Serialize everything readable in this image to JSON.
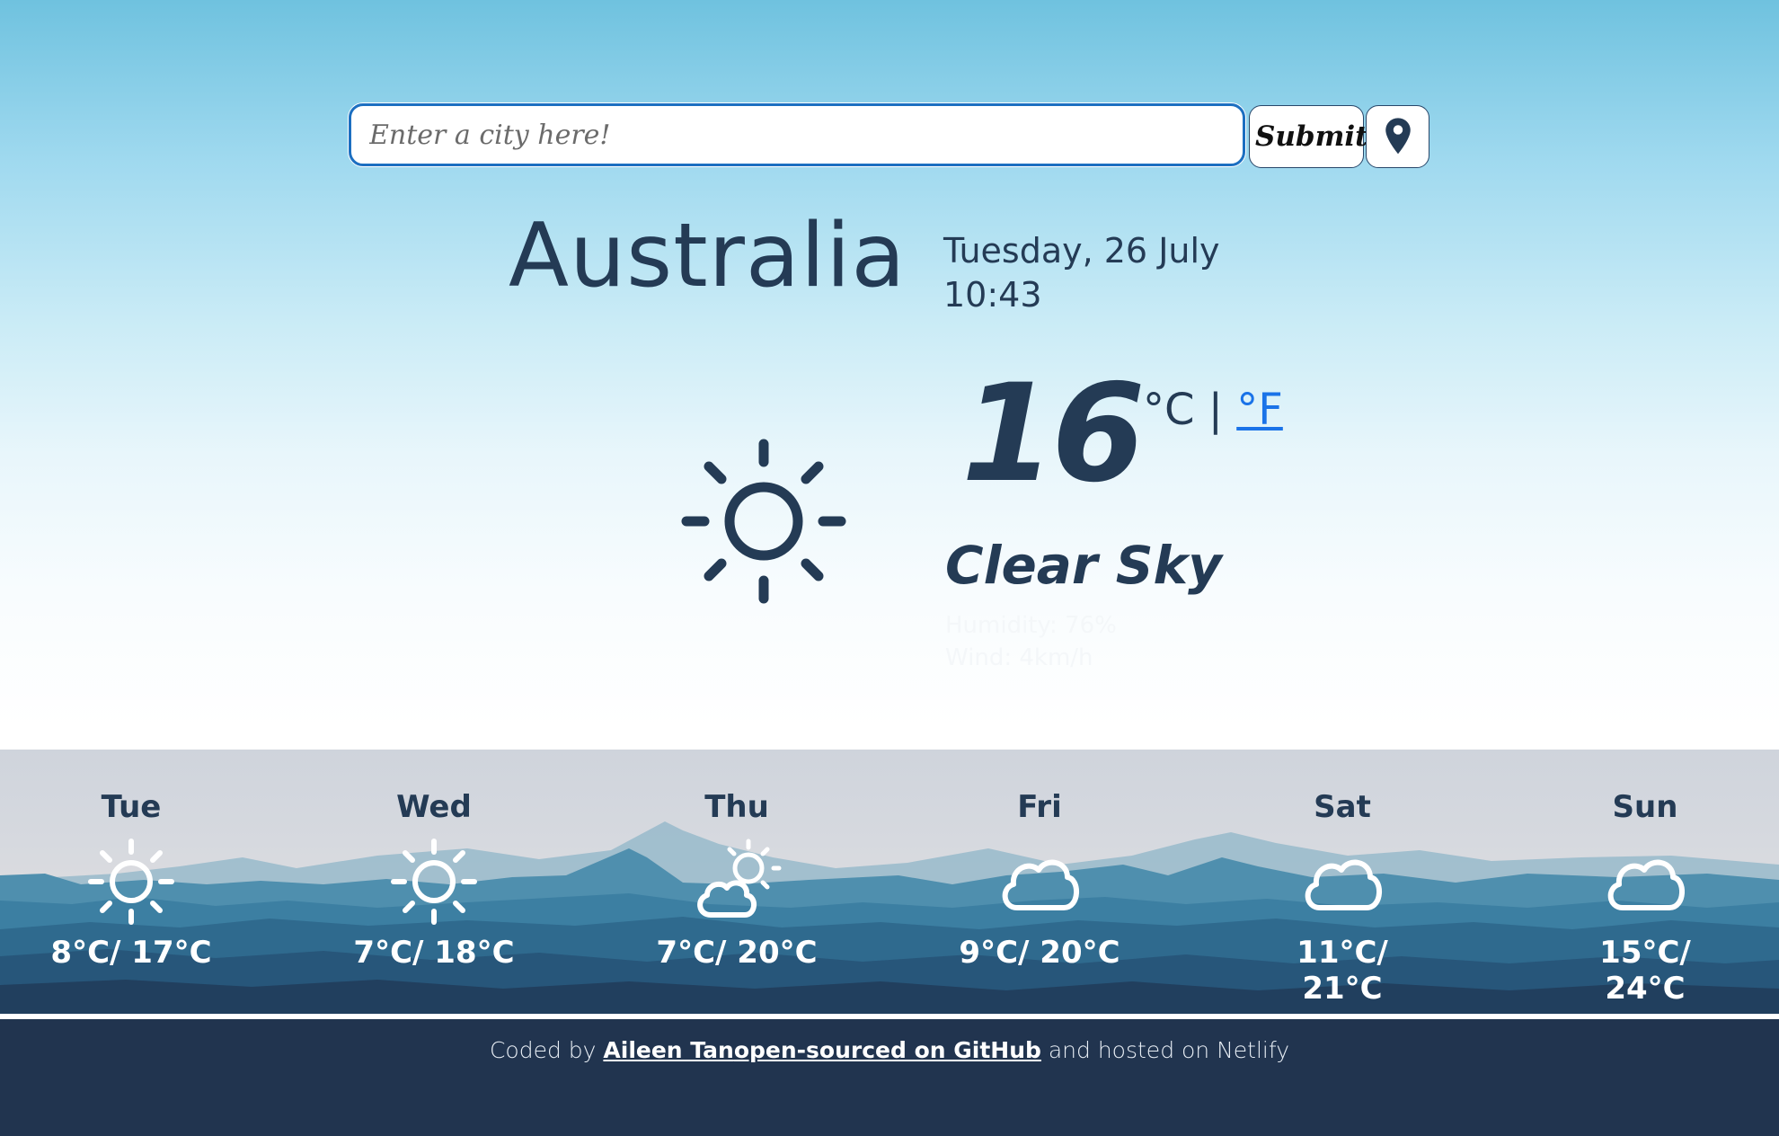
{
  "search": {
    "placeholder": "Enter a city here!",
    "value": "",
    "submit_label": "Submit",
    "location_icon": "map-pin-icon"
  },
  "current": {
    "city": "Australia",
    "date": "Tuesday, 26 July",
    "time": "10:43",
    "temperature": "16",
    "unit_c": "°C",
    "separator": "|",
    "unit_f": "°F",
    "description": "Clear Sky",
    "humidity": "Humidity: 76%",
    "wind": "Wind: 4km/h",
    "icon": "sun-icon"
  },
  "forecast": [
    {
      "day": "Tue",
      "range": "8°C/ 17°C",
      "icon": "sun-icon"
    },
    {
      "day": "Wed",
      "range": "7°C/ 18°C",
      "icon": "sun-icon"
    },
    {
      "day": "Thu",
      "range": "7°C/ 20°C",
      "icon": "partly-cloudy-icon"
    },
    {
      "day": "Fri",
      "range": "9°C/ 20°C",
      "icon": "cloud-icon"
    },
    {
      "day": "Sat",
      "range": "11°C/ 21°C",
      "icon": "cloud-icon"
    },
    {
      "day": "Sun",
      "range": "15°C/ 24°C",
      "icon": "cloud-icon"
    }
  ],
  "footer": {
    "coded_by": "Coded by",
    "author": "Aileen Tan",
    "github_link": "open-sourced on GitHub",
    "hosted": "and hosted on Netlify"
  },
  "colors": {
    "text_dark": "#243b55",
    "link_blue": "#1a73e8",
    "footer_bg": "#21344f",
    "input_border": "#1c6fc1"
  }
}
